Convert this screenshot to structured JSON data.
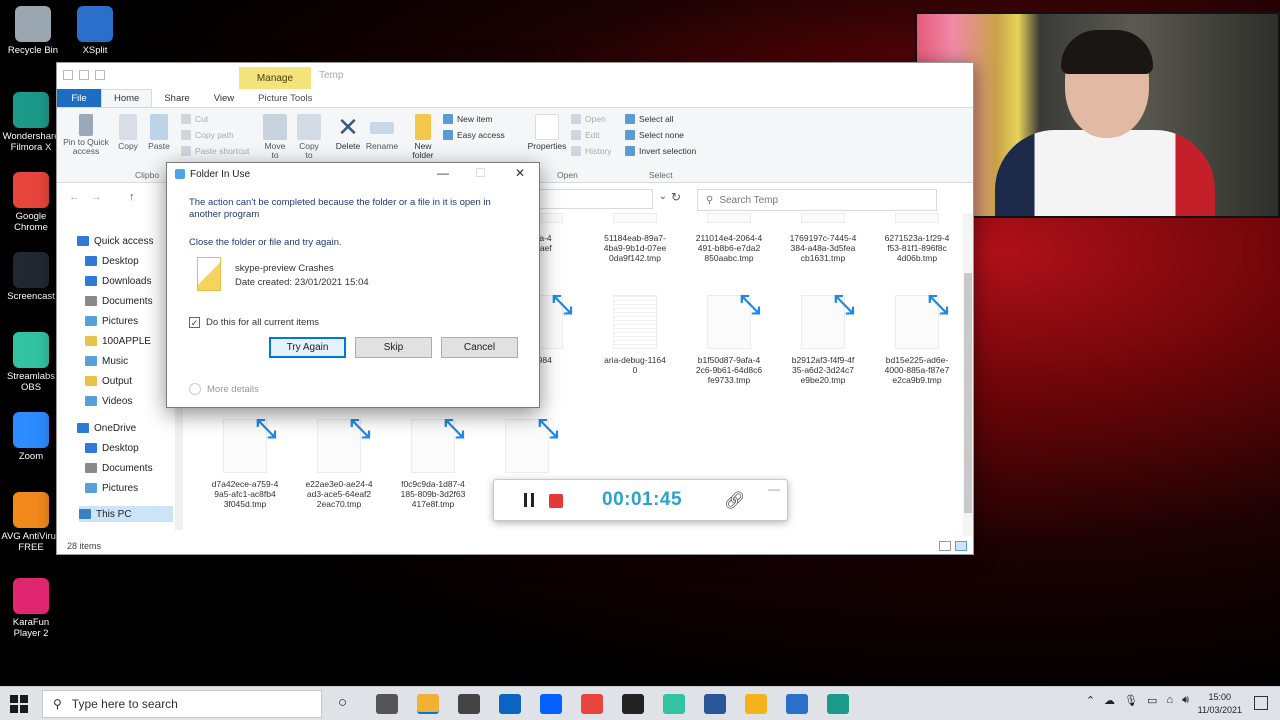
{
  "desktop_icons": [
    {
      "label": "Recycle Bin",
      "color": "#9aa7b0"
    },
    {
      "label": "XSplit",
      "color": "#2a6fc9"
    },
    {
      "label": "Wondershare Filmora X",
      "color": "#1b9a8a"
    },
    {
      "label": "Google Chrome",
      "color": "#e8453c"
    },
    {
      "label": "Screencast",
      "color": "#222831"
    },
    {
      "label": "Streamlabs OBS",
      "color": "#31c3a2"
    },
    {
      "label": "Zoom",
      "color": "#2d8cff"
    },
    {
      "label": "AVG AntiVirus FREE",
      "color": "#f28a1b"
    },
    {
      "label": "KaraFun Player 2",
      "color": "#e0266f"
    }
  ],
  "explorer": {
    "contextual_tab": "Manage",
    "title": "Temp",
    "tabs": [
      "File",
      "Home",
      "Share",
      "View",
      "Picture Tools"
    ],
    "ribbon": {
      "pin": "Pin to Quick access",
      "copy": "Copy",
      "paste": "Paste",
      "cut": "Cut",
      "copy_path": "Copy path",
      "paste_shortcut": "Paste shortcut",
      "move_to": "Move to",
      "copy_to": "Copy to",
      "delete": "Delete",
      "rename": "Rename",
      "new_folder": "New folder",
      "new_item": "New item",
      "easy_access": "Easy access",
      "properties": "Properties",
      "open": "Open",
      "edit": "Edit",
      "history": "History",
      "select_all": "Select all",
      "select_none": "Select none",
      "invert_selection": "Invert selection",
      "group_clipboard": "Clipbo",
      "group_open": "Open",
      "group_select": "Select"
    },
    "search_placeholder": "Search Temp",
    "sidebar": [
      {
        "label": "Quick access",
        "color": "#2f7ad6",
        "level": 0
      },
      {
        "label": "Desktop",
        "color": "#2f7ad6",
        "level": 1
      },
      {
        "label": "Downloads",
        "color": "#2f7ad6",
        "level": 1
      },
      {
        "label": "Documents",
        "color": "#8a8a8a",
        "level": 1
      },
      {
        "label": "Pictures",
        "color": "#5aa0d8",
        "level": 1
      },
      {
        "label": "100APPLE",
        "color": "#e9c349",
        "level": 1
      },
      {
        "label": "Music",
        "color": "#5aa0d8",
        "level": 1
      },
      {
        "label": "Output",
        "color": "#e9c349",
        "level": 1
      },
      {
        "label": "Videos",
        "color": "#5aa0d8",
        "level": 1
      },
      {
        "label": "OneDrive",
        "color": "#2f7ad6",
        "level": 0
      },
      {
        "label": "Desktop",
        "color": "#2f7ad6",
        "level": 1
      },
      {
        "label": "Documents",
        "color": "#8a8a8a",
        "level": 1
      },
      {
        "label": "Pictures",
        "color": "#5aa0d8",
        "level": 1
      },
      {
        "label": "This PC",
        "color": "#3b80c4",
        "level": 0,
        "selected": true
      }
    ],
    "files_row1": [
      {
        "name": "cda-4\n35aef"
      },
      {
        "name": "51184eab-89a7-\n4ba9-9b1d-07ee\n0da9f142.tmp"
      },
      {
        "name": "211014e4-2064-4\n491-b8b6-e7da2\n850aabc.tmp"
      },
      {
        "name": "1769197c-7445-4\n384-a48a-3d5fea\ncb1631.tmp"
      },
      {
        "name": "6271523a-1f29-4\nf53-81f1-896f8c\n4d06b.tmp"
      }
    ],
    "files_row2": [
      {
        "name": "-3984",
        "arrow": true
      },
      {
        "name": "aria-debug-1164\n0",
        "arrow": false
      },
      {
        "name": "b1f50d87-9afa-4\n2c6-9b61-64d8c6\nfe9733.tmp",
        "arrow": true
      },
      {
        "name": "b2912af3-f4f9-4f\n35-a6d2-3d24c7\ne9be20.tmp",
        "arrow": true
      },
      {
        "name": "bd15e225-ad6e-\n4000-885a-f87e7\ne2ca9b9.tmp",
        "arrow": true
      }
    ],
    "files_row3": [
      {
        "name": "d7a42ece-a759-4\n9a5-afc1-ac8fb4\n3f045d.tmp"
      },
      {
        "name": "e22ae3e0-ae24-4\nad3-ace5-64eaf2\n2eac70.tmp"
      },
      {
        "name": "f0c9c9da-1d87-4\n185-809b-3d2f63\n417e8f.tmp"
      },
      {
        "name": ""
      }
    ],
    "status": "28 items"
  },
  "dialog": {
    "title": "Folder In Use",
    "message": "The action can't be completed because the folder or a file in it is open in another program",
    "instruction": "Close the folder or file and try again.",
    "file_name": "skype-preview Crashes",
    "date_created": "Date created: 23/01/2021 15:04",
    "checkbox_label": "Do this for all current items",
    "checkbox_checked": true,
    "try_again": "Try Again",
    "skip": "Skip",
    "cancel": "Cancel",
    "more_details": "More details"
  },
  "recorder": {
    "time": "00:01:45"
  },
  "taskbar": {
    "search_placeholder": "Type here to search",
    "time": "15:00",
    "date": "11/03/2021",
    "apps": [
      {
        "name": "task-view",
        "color": "#555"
      },
      {
        "name": "file-explorer",
        "color": "#f2b134",
        "active": true
      },
      {
        "name": "store",
        "color": "#444"
      },
      {
        "name": "mail",
        "color": "#0a64c2"
      },
      {
        "name": "dropbox",
        "color": "#0061fe"
      },
      {
        "name": "chrome",
        "color": "#e8453c"
      },
      {
        "name": "xbox",
        "color": "#222"
      },
      {
        "name": "streamlabs",
        "color": "#31c3a2"
      },
      {
        "name": "word",
        "color": "#2b579a"
      },
      {
        "name": "vlc",
        "color": "#f5b21a"
      },
      {
        "name": "xsplit",
        "color": "#2a6fc9"
      },
      {
        "name": "filmora",
        "color": "#1b9a8a"
      }
    ]
  }
}
